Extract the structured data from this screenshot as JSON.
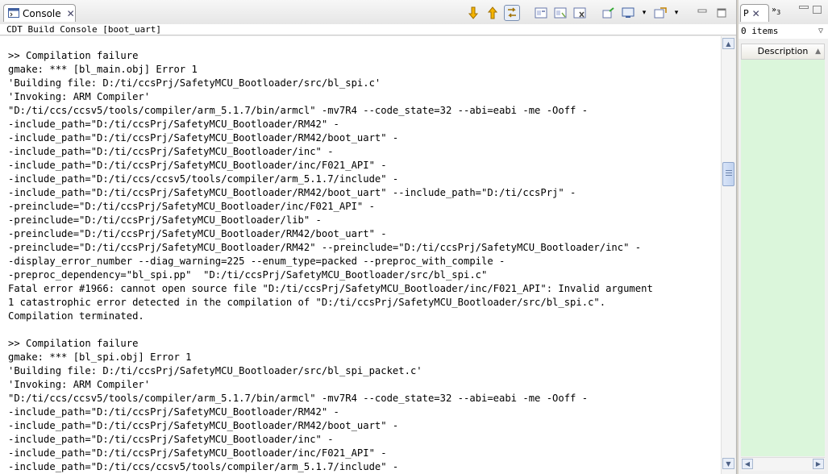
{
  "console": {
    "tab_label": "Console",
    "title": "CDT Build Console [boot_uart]",
    "lines": [
      ">> Compilation failure",
      "gmake: *** [bl_main.obj] Error 1",
      "'Building file: D:/ti/ccsPrj/SafetyMCU_Bootloader/src/bl_spi.c'",
      "'Invoking: ARM Compiler'",
      "\"D:/ti/ccs/ccsv5/tools/compiler/arm_5.1.7/bin/armcl\" -mv7R4 --code_state=32 --abi=eabi -me -Ooff -",
      "-include_path=\"D:/ti/ccsPrj/SafetyMCU_Bootloader/RM42\" -",
      "-include_path=\"D:/ti/ccsPrj/SafetyMCU_Bootloader/RM42/boot_uart\" -",
      "-include_path=\"D:/ti/ccsPrj/SafetyMCU_Bootloader/inc\" -",
      "-include_path=\"D:/ti/ccsPrj/SafetyMCU_Bootloader/inc/F021_API\" -",
      "-include_path=\"D:/ti/ccs/ccsv5/tools/compiler/arm_5.1.7/include\" -",
      "-include_path=\"D:/ti/ccsPrj/SafetyMCU_Bootloader/RM42/boot_uart\" --include_path=\"D:/ti/ccsPrj\" -",
      "-preinclude=\"D:/ti/ccsPrj/SafetyMCU_Bootloader/inc/F021_API\" -",
      "-preinclude=\"D:/ti/ccsPrj/SafetyMCU_Bootloader/lib\" -",
      "-preinclude=\"D:/ti/ccsPrj/SafetyMCU_Bootloader/RM42/boot_uart\" -",
      "-preinclude=\"D:/ti/ccsPrj/SafetyMCU_Bootloader/RM42\" --preinclude=\"D:/ti/ccsPrj/SafetyMCU_Bootloader/inc\" -",
      "-display_error_number --diag_warning=225 --enum_type=packed --preproc_with_compile -",
      "-preproc_dependency=\"bl_spi.pp\"  \"D:/ti/ccsPrj/SafetyMCU_Bootloader/src/bl_spi.c\"",
      "Fatal error #1966: cannot open source file \"D:/ti/ccsPrj/SafetyMCU_Bootloader/inc/F021_API\": Invalid argument",
      "1 catastrophic error detected in the compilation of \"D:/ti/ccsPrj/SafetyMCU_Bootloader/src/bl_spi.c\".",
      "Compilation terminated.",
      "",
      ">> Compilation failure",
      "gmake: *** [bl_spi.obj] Error 1",
      "'Building file: D:/ti/ccsPrj/SafetyMCU_Bootloader/src/bl_spi_packet.c'",
      "'Invoking: ARM Compiler'",
      "\"D:/ti/ccs/ccsv5/tools/compiler/arm_5.1.7/bin/armcl\" -mv7R4 --code_state=32 --abi=eabi -me -Ooff -",
      "-include_path=\"D:/ti/ccsPrj/SafetyMCU_Bootloader/RM42\" -",
      "-include_path=\"D:/ti/ccsPrj/SafetyMCU_Bootloader/RM42/boot_uart\" -",
      "-include_path=\"D:/ti/ccsPrj/SafetyMCU_Bootloader/inc\" -",
      "-include_path=\"D:/ti/ccsPrj/SafetyMCU_Bootloader/inc/F021_API\" -",
      "-include_path=\"D:/ti/ccs/ccsv5/tools/compiler/arm_5.1.7/include\" -"
    ]
  },
  "side_panel": {
    "tab_label": "P",
    "overflow_label": "»",
    "overflow_count": "3",
    "status": "0 items",
    "column_header": "Description"
  },
  "colors": {
    "list_background": "#dbf6db",
    "arrow_icon": "#f0a800"
  }
}
